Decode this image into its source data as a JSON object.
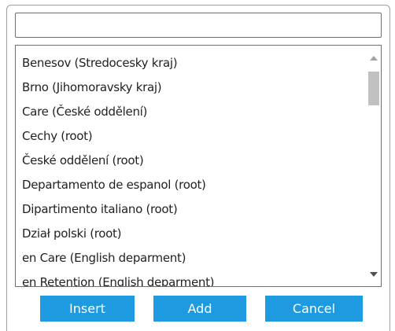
{
  "dialog": {
    "search": {
      "value": "",
      "placeholder": ""
    },
    "list": {
      "items": [
        "Benesov (Stredocesky kraj)",
        "Brno (Jihomoravsky kraj)",
        "Care (České oddělení)",
        "Cechy (root)",
        "České oddělení (root)",
        "Departamento de espanol (root)",
        "Dipartimento italiano (root)",
        "Dział polski (root)",
        "en Care (English deparment)",
        "en Retention (English deparment)"
      ],
      "scroll_position": 0.1
    },
    "buttons": {
      "insert": "Insert",
      "add": "Add",
      "cancel": "Cancel"
    },
    "colors": {
      "button_bg": "#1e9ae0",
      "button_text": "#ffffff",
      "border": "#6f6f6f"
    }
  }
}
